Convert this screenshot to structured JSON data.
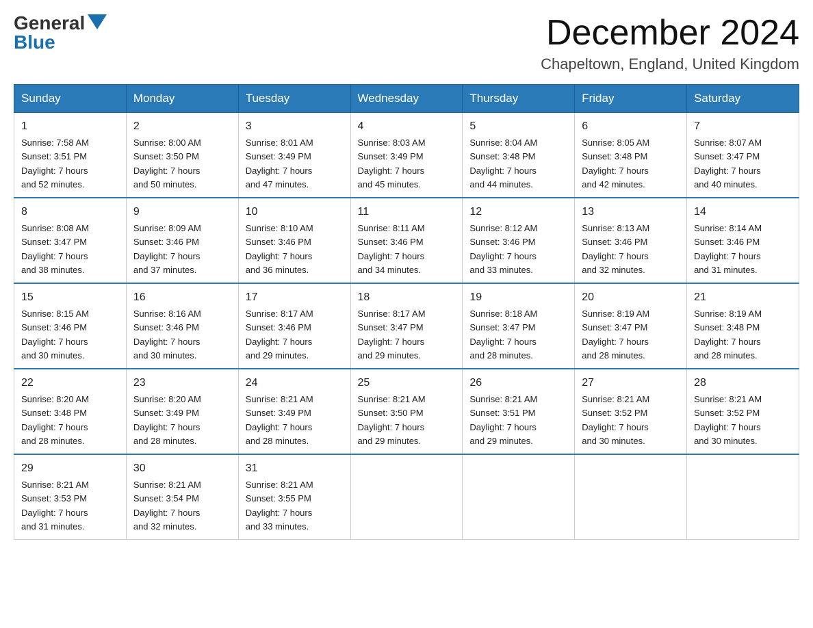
{
  "header": {
    "logo_general": "General",
    "logo_blue": "Blue",
    "month_title": "December 2024",
    "location": "Chapeltown, England, United Kingdom"
  },
  "days_of_week": [
    "Sunday",
    "Monday",
    "Tuesday",
    "Wednesday",
    "Thursday",
    "Friday",
    "Saturday"
  ],
  "weeks": [
    [
      {
        "day": "1",
        "sunrise": "7:58 AM",
        "sunset": "3:51 PM",
        "daylight": "7 hours and 52 minutes."
      },
      {
        "day": "2",
        "sunrise": "8:00 AM",
        "sunset": "3:50 PM",
        "daylight": "7 hours and 50 minutes."
      },
      {
        "day": "3",
        "sunrise": "8:01 AM",
        "sunset": "3:49 PM",
        "daylight": "7 hours and 47 minutes."
      },
      {
        "day": "4",
        "sunrise": "8:03 AM",
        "sunset": "3:49 PM",
        "daylight": "7 hours and 45 minutes."
      },
      {
        "day": "5",
        "sunrise": "8:04 AM",
        "sunset": "3:48 PM",
        "daylight": "7 hours and 44 minutes."
      },
      {
        "day": "6",
        "sunrise": "8:05 AM",
        "sunset": "3:48 PM",
        "daylight": "7 hours and 42 minutes."
      },
      {
        "day": "7",
        "sunrise": "8:07 AM",
        "sunset": "3:47 PM",
        "daylight": "7 hours and 40 minutes."
      }
    ],
    [
      {
        "day": "8",
        "sunrise": "8:08 AM",
        "sunset": "3:47 PM",
        "daylight": "7 hours and 38 minutes."
      },
      {
        "day": "9",
        "sunrise": "8:09 AM",
        "sunset": "3:46 PM",
        "daylight": "7 hours and 37 minutes."
      },
      {
        "day": "10",
        "sunrise": "8:10 AM",
        "sunset": "3:46 PM",
        "daylight": "7 hours and 36 minutes."
      },
      {
        "day": "11",
        "sunrise": "8:11 AM",
        "sunset": "3:46 PM",
        "daylight": "7 hours and 34 minutes."
      },
      {
        "day": "12",
        "sunrise": "8:12 AM",
        "sunset": "3:46 PM",
        "daylight": "7 hours and 33 minutes."
      },
      {
        "day": "13",
        "sunrise": "8:13 AM",
        "sunset": "3:46 PM",
        "daylight": "7 hours and 32 minutes."
      },
      {
        "day": "14",
        "sunrise": "8:14 AM",
        "sunset": "3:46 PM",
        "daylight": "7 hours and 31 minutes."
      }
    ],
    [
      {
        "day": "15",
        "sunrise": "8:15 AM",
        "sunset": "3:46 PM",
        "daylight": "7 hours and 30 minutes."
      },
      {
        "day": "16",
        "sunrise": "8:16 AM",
        "sunset": "3:46 PM",
        "daylight": "7 hours and 30 minutes."
      },
      {
        "day": "17",
        "sunrise": "8:17 AM",
        "sunset": "3:46 PM",
        "daylight": "7 hours and 29 minutes."
      },
      {
        "day": "18",
        "sunrise": "8:17 AM",
        "sunset": "3:47 PM",
        "daylight": "7 hours and 29 minutes."
      },
      {
        "day": "19",
        "sunrise": "8:18 AM",
        "sunset": "3:47 PM",
        "daylight": "7 hours and 28 minutes."
      },
      {
        "day": "20",
        "sunrise": "8:19 AM",
        "sunset": "3:47 PM",
        "daylight": "7 hours and 28 minutes."
      },
      {
        "day": "21",
        "sunrise": "8:19 AM",
        "sunset": "3:48 PM",
        "daylight": "7 hours and 28 minutes."
      }
    ],
    [
      {
        "day": "22",
        "sunrise": "8:20 AM",
        "sunset": "3:48 PM",
        "daylight": "7 hours and 28 minutes."
      },
      {
        "day": "23",
        "sunrise": "8:20 AM",
        "sunset": "3:49 PM",
        "daylight": "7 hours and 28 minutes."
      },
      {
        "day": "24",
        "sunrise": "8:21 AM",
        "sunset": "3:49 PM",
        "daylight": "7 hours and 28 minutes."
      },
      {
        "day": "25",
        "sunrise": "8:21 AM",
        "sunset": "3:50 PM",
        "daylight": "7 hours and 29 minutes."
      },
      {
        "day": "26",
        "sunrise": "8:21 AM",
        "sunset": "3:51 PM",
        "daylight": "7 hours and 29 minutes."
      },
      {
        "day": "27",
        "sunrise": "8:21 AM",
        "sunset": "3:52 PM",
        "daylight": "7 hours and 30 minutes."
      },
      {
        "day": "28",
        "sunrise": "8:21 AM",
        "sunset": "3:52 PM",
        "daylight": "7 hours and 30 minutes."
      }
    ],
    [
      {
        "day": "29",
        "sunrise": "8:21 AM",
        "sunset": "3:53 PM",
        "daylight": "7 hours and 31 minutes."
      },
      {
        "day": "30",
        "sunrise": "8:21 AM",
        "sunset": "3:54 PM",
        "daylight": "7 hours and 32 minutes."
      },
      {
        "day": "31",
        "sunrise": "8:21 AM",
        "sunset": "3:55 PM",
        "daylight": "7 hours and 33 minutes."
      },
      null,
      null,
      null,
      null
    ]
  ],
  "labels": {
    "sunrise": "Sunrise:",
    "sunset": "Sunset:",
    "daylight": "Daylight:"
  }
}
